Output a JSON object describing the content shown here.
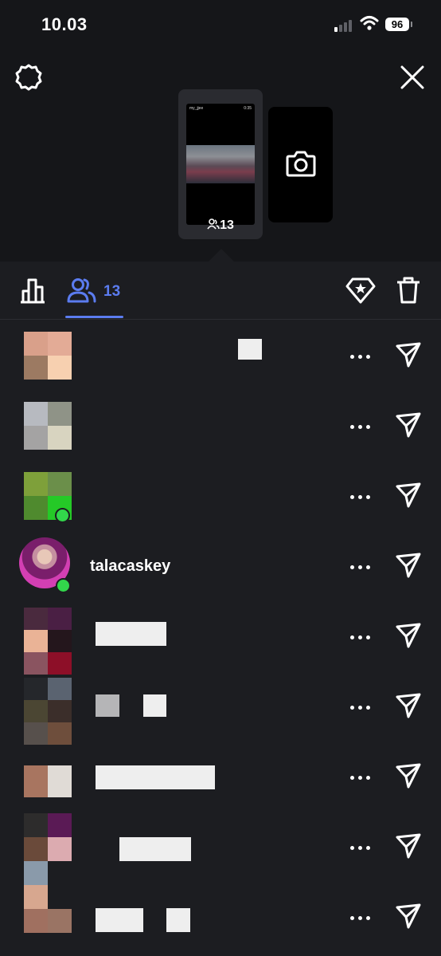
{
  "status_bar": {
    "time": "10.03",
    "battery": "96"
  },
  "story": {
    "viewer_count": "13",
    "thumb_header_left": "my_jjee",
    "thumb_header_right": "0:35"
  },
  "tabs": {
    "viewers_count": "13"
  },
  "viewers": [
    {
      "username": "",
      "online": false
    },
    {
      "username": "",
      "online": false
    },
    {
      "username": "",
      "online": true
    },
    {
      "username": "talacaskey",
      "online": true
    },
    {
      "username": "",
      "online": false
    },
    {
      "username": "",
      "online": false
    },
    {
      "username": "",
      "online": false
    },
    {
      "username": "",
      "online": false
    },
    {
      "username": "",
      "online": false
    }
  ],
  "colors": {
    "accent": "#5b7cf0",
    "online": "#32d74b",
    "background": "#1c1d21"
  }
}
